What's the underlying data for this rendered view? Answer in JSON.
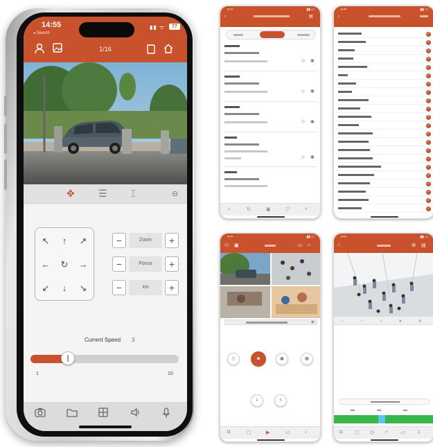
{
  "main_phone": {
    "status": {
      "time": "14:55",
      "back_label": "◂ Search",
      "signal": "▮▮ ᯤ",
      "battery": "77"
    },
    "header": {
      "title": "1/16",
      "icons": [
        "person-icon",
        "image-icon",
        "window-icon",
        "home-icon"
      ]
    },
    "ptz_tabs": [
      "ptz-icon",
      "settings-sliders-icon",
      "preset-icon",
      "more-icon"
    ],
    "dpad": [
      "↖",
      "↑",
      "↗",
      "←",
      "↻",
      "→",
      "↙",
      "↓",
      "↘"
    ],
    "controls": [
      {
        "label": "Zoom",
        "minus": "−",
        "plus": "+"
      },
      {
        "label": "Focus",
        "minus": "−",
        "plus": "+"
      },
      {
        "label": "Iris",
        "minus": "−",
        "plus": "+"
      }
    ],
    "speed": {
      "label": "Current Speed",
      "value": "3",
      "min": "1",
      "max": "10",
      "fraction": 0.2
    },
    "bottom_bar": [
      "camera-icon",
      "folder-icon",
      "grid-icon",
      "speaker-icon",
      "microphone-icon"
    ]
  },
  "colors": {
    "accent": "#c8522c"
  }
}
